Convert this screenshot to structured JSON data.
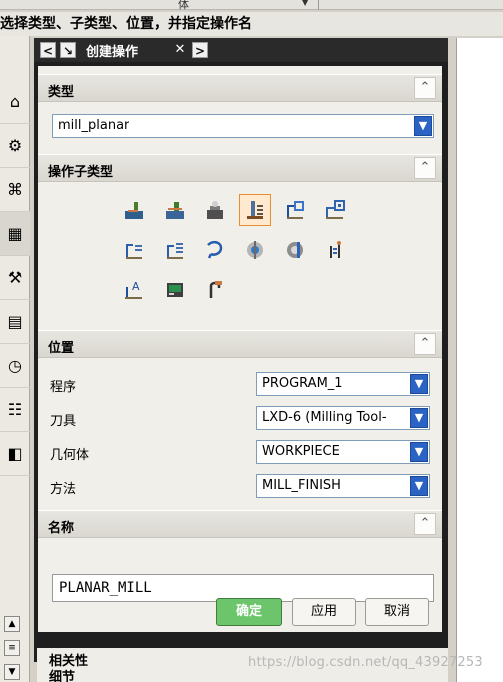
{
  "window": {
    "top_fragment": "体",
    "cue_line": "选择类型、子类型、位置，并指定操作名"
  },
  "dialog": {
    "tab_title": "创建操作",
    "tab_left": "<",
    "tab_down": "↘",
    "tab_close": "✕",
    "tab_right": ">",
    "sections": {
      "type": {
        "title": "类型",
        "value": "mill_planar"
      },
      "subtype": {
        "title": "操作子类型"
      },
      "location": {
        "title": "位置",
        "fields": [
          {
            "label": "程序",
            "value": "PROGRAM_1"
          },
          {
            "label": "刀具",
            "value": "LXD-6 (Milling Tool-"
          },
          {
            "label": "几何体",
            "value": "WORKPIECE"
          },
          {
            "label": "方法",
            "value": "MILL_FINISH"
          }
        ]
      },
      "name": {
        "title": "名称",
        "value": "PLANAR_MILL"
      }
    },
    "buttons": {
      "ok": "确定",
      "apply": "应用",
      "cancel": "取消"
    },
    "footer": {
      "relevance": "相关性",
      "details": "细节"
    }
  },
  "watermark": "https://blog.csdn.net/qq_43927253",
  "colors": {
    "dialog_frame": "#1f1f1f",
    "accent_blue": "#2b63c4",
    "ok_green": "#6cc56b",
    "active_icon": "#ffe9cf"
  },
  "icons": {
    "left_toolbar": [
      "tree-icon",
      "settings-icon",
      "hierarchy-icon",
      "model-icon",
      "tool-icon",
      "document-icon",
      "clock-icon",
      "list-icon",
      "palette-icon"
    ],
    "subtype_icons": [
      "face-mill-area-icon",
      "face-mill-icon",
      "face-mill-manual-icon",
      "planar-mill-icon",
      "planar-profile-icon",
      "cleanup-corners-icon",
      "finish-walls-icon",
      "finish-floor-icon",
      "groove-mill-icon",
      "hole-chamfer-icon",
      "solid-profile-icon",
      "thread-mill-icon",
      "planar-text-icon",
      "mill-control-icon",
      "mill-user-icon"
    ]
  }
}
